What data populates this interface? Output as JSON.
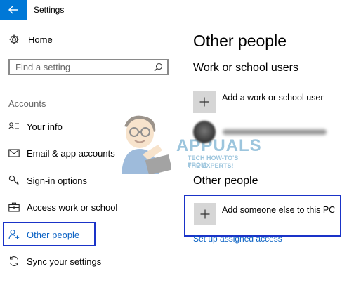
{
  "window": {
    "title": "Settings"
  },
  "sidebar": {
    "home_label": "Home",
    "search": {
      "placeholder": "Find a setting"
    },
    "section_label": "Accounts",
    "items": [
      {
        "label": "Your info",
        "icon": "person-card-icon"
      },
      {
        "label": "Email & app accounts",
        "icon": "mail-icon"
      },
      {
        "label": "Sign-in options",
        "icon": "key-icon"
      },
      {
        "label": "Access work or school",
        "icon": "briefcase-icon"
      },
      {
        "label": "Other people",
        "icon": "person-add-icon",
        "active": true
      },
      {
        "label": "Sync your settings",
        "icon": "sync-icon"
      }
    ]
  },
  "main": {
    "title": "Other people",
    "work_section": {
      "heading": "Work or school users",
      "add_label": "Add a work or school user"
    },
    "other_section": {
      "heading": "Other people",
      "add_label": "Add someone else to this PC"
    },
    "assigned_access_link": "Set up assigned access"
  },
  "watermark": {
    "brand": "APPUALS",
    "tagline_1": "TECH HOW-TO'S FROM",
    "tagline_2": "THE EXPERTS!"
  },
  "colors": {
    "accent": "#0078d7",
    "link": "#0b62c4",
    "highlight": "#1a33c8",
    "tile": "#d6d6d6"
  }
}
